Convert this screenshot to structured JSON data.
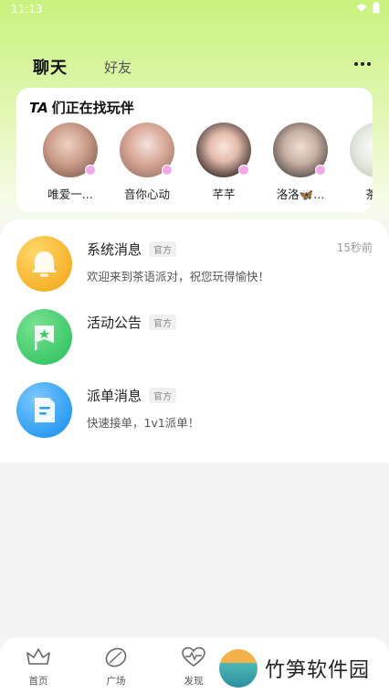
{
  "status_bar": {
    "time": "11:13"
  },
  "header": {
    "tabs": [
      {
        "label": "聊天",
        "active": true
      },
      {
        "label": "好友",
        "active": false
      }
    ],
    "more_icon": "more-dots-icon"
  },
  "finder": {
    "title_prefix": "TA",
    "title": "们正在找玩伴",
    "users": [
      {
        "name": "唯爱一...",
        "badge_color": "#f3a9e9"
      },
      {
        "name": "音你心动",
        "badge_color": "#f3a9e9"
      },
      {
        "name": "芊芊",
        "badge_color": "#f3a9e9"
      },
      {
        "name": "洛洛🦋...",
        "badge_color": "#f3a9e9"
      },
      {
        "name": "茶语",
        "badge_color": "#f3a9e9"
      }
    ]
  },
  "messages": [
    {
      "title": "系统消息",
      "tag": "官方",
      "preview": "欢迎来到茶语派对，祝您玩得愉快！",
      "time": "15秒前",
      "icon": "bell-icon",
      "color": "#f6b22b"
    },
    {
      "title": "活动公告",
      "tag": "官方",
      "preview": "",
      "time": "",
      "icon": "flag-icon",
      "color": "#3ec96a"
    },
    {
      "title": "派单消息",
      "tag": "官方",
      "preview": "快速接单，1v1派单！",
      "time": "",
      "icon": "document-icon",
      "color": "#2f9df2"
    }
  ],
  "bottom_nav": {
    "items": [
      {
        "label": "首页",
        "icon": "crown-icon"
      },
      {
        "label": "广场",
        "icon": "leaf-icon"
      },
      {
        "label": "发现",
        "icon": "heart-pulse-icon"
      }
    ]
  },
  "watermark": {
    "text": "竹笋软件园"
  }
}
